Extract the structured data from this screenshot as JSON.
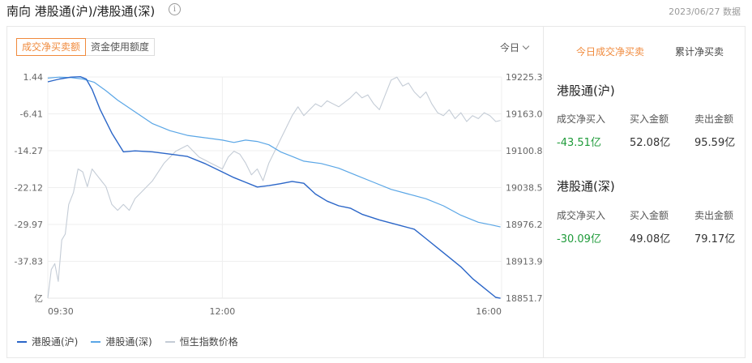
{
  "header": {
    "title": "南向 港股通(沪)/港股通(深)",
    "info_icon": "i",
    "date_note": "2023/06/27 数据"
  },
  "chart_tabs": [
    "成交净买卖额",
    "资金使用额度"
  ],
  "period_selector": "今日",
  "side": {
    "tabs": [
      "今日成交净买卖",
      "累计净买卖"
    ],
    "blocks": [
      {
        "name": "港股通(沪)",
        "labels": [
          "成交净买入",
          "买入金额",
          "卖出金额"
        ],
        "values": [
          "-43.51亿",
          "52.08亿",
          "95.59亿"
        ]
      },
      {
        "name": "港股通(深)",
        "labels": [
          "成交净买入",
          "买入金额",
          "卖出金额"
        ],
        "values": [
          "-30.09亿",
          "49.08亿",
          "79.17亿"
        ]
      }
    ]
  },
  "colors": {
    "accent": "#f08a3c",
    "sh_line": "#2b66c8",
    "sz_line": "#5aa6e6",
    "hsi_line": "#c4ccd6",
    "negative": "#1f9b3a"
  },
  "chart_data": {
    "type": "line",
    "x_ticks": [
      "09:30",
      "12:00",
      "16:00"
    ],
    "y_left_unit": "亿",
    "y_left_ticks": [
      "1.44",
      "-6.41",
      "-14.27",
      "-22.12",
      "-29.97",
      "-37.83"
    ],
    "y_left_range": [
      -45.68,
      1.44
    ],
    "y_right_ticks": [
      "19225.3",
      "19163.0",
      "19100.8",
      "19038.5",
      "18976.2",
      "18913.9",
      "18851.7"
    ],
    "y_right_range": [
      18851.7,
      19225.3
    ],
    "x_range_min": [
      0,
      390
    ],
    "series": [
      {
        "name": "港股通(沪)",
        "axis": "left",
        "points": [
          [
            0,
            0.4
          ],
          [
            10,
            1.0
          ],
          [
            20,
            1.4
          ],
          [
            28,
            1.5
          ],
          [
            33,
            1.0
          ],
          [
            38,
            -1.2
          ],
          [
            45,
            -5.5
          ],
          [
            55,
            -10.5
          ],
          [
            65,
            -14.5
          ],
          [
            75,
            -14.3
          ],
          [
            90,
            -14.5
          ],
          [
            105,
            -15.0
          ],
          [
            120,
            -15.5
          ],
          [
            135,
            -17.0
          ],
          [
            150,
            -18.8
          ],
          [
            160,
            -20.0
          ],
          [
            170,
            -21.0
          ],
          [
            180,
            -22.0
          ],
          [
            190,
            -21.7
          ],
          [
            200,
            -21.3
          ],
          [
            210,
            -20.8
          ],
          [
            220,
            -21.2
          ],
          [
            230,
            -23.5
          ],
          [
            240,
            -25.0
          ],
          [
            250,
            -26.0
          ],
          [
            260,
            -26.5
          ],
          [
            270,
            -27.8
          ],
          [
            285,
            -29.0
          ],
          [
            300,
            -30.0
          ],
          [
            315,
            -31.0
          ],
          [
            325,
            -33.0
          ],
          [
            335,
            -35.0
          ],
          [
            345,
            -37.0
          ],
          [
            355,
            -39.0
          ],
          [
            365,
            -41.5
          ],
          [
            375,
            -43.5
          ],
          [
            385,
            -45.5
          ],
          [
            389,
            -45.7
          ]
        ]
      },
      {
        "name": "港股通(深)",
        "axis": "left",
        "points": [
          [
            0,
            1.2
          ],
          [
            10,
            1.4
          ],
          [
            20,
            1.3
          ],
          [
            30,
            1.0
          ],
          [
            40,
            0.3
          ],
          [
            50,
            -1.5
          ],
          [
            60,
            -3.5
          ],
          [
            75,
            -6.0
          ],
          [
            90,
            -8.5
          ],
          [
            105,
            -10.0
          ],
          [
            120,
            -11.0
          ],
          [
            135,
            -11.5
          ],
          [
            150,
            -12.0
          ],
          [
            160,
            -12.5
          ],
          [
            170,
            -12.0
          ],
          [
            180,
            -12.3
          ],
          [
            190,
            -13.0
          ],
          [
            200,
            -14.5
          ],
          [
            210,
            -15.5
          ],
          [
            220,
            -16.5
          ],
          [
            235,
            -17.0
          ],
          [
            250,
            -18.0
          ],
          [
            265,
            -19.5
          ],
          [
            280,
            -21.0
          ],
          [
            295,
            -22.5
          ],
          [
            310,
            -23.5
          ],
          [
            325,
            -24.5
          ],
          [
            340,
            -26.0
          ],
          [
            355,
            -28.0
          ],
          [
            370,
            -29.5
          ],
          [
            380,
            -30.0
          ],
          [
            389,
            -30.5
          ]
        ]
      },
      {
        "name": "恒生指数价格",
        "axis": "right",
        "points": [
          [
            0,
            18852
          ],
          [
            3,
            18900
          ],
          [
            6,
            18910
          ],
          [
            9,
            18880
          ],
          [
            12,
            18950
          ],
          [
            15,
            18960
          ],
          [
            18,
            19010
          ],
          [
            22,
            19030
          ],
          [
            26,
            19070
          ],
          [
            30,
            19065
          ],
          [
            34,
            19040
          ],
          [
            38,
            19070
          ],
          [
            42,
            19060
          ],
          [
            46,
            19050
          ],
          [
            50,
            19040
          ],
          [
            55,
            19010
          ],
          [
            60,
            19000
          ],
          [
            65,
            19010
          ],
          [
            70,
            19000
          ],
          [
            75,
            19020
          ],
          [
            80,
            19030
          ],
          [
            85,
            19040
          ],
          [
            90,
            19050
          ],
          [
            100,
            19080
          ],
          [
            110,
            19100
          ],
          [
            120,
            19110
          ],
          [
            130,
            19090
          ],
          [
            140,
            19080
          ],
          [
            150,
            19070
          ],
          [
            155,
            19090
          ],
          [
            160,
            19100
          ],
          [
            165,
            19095
          ],
          [
            170,
            19080
          ],
          [
            175,
            19060
          ],
          [
            180,
            19070
          ],
          [
            185,
            19050
          ],
          [
            190,
            19080
          ],
          [
            195,
            19100
          ],
          [
            200,
            19120
          ],
          [
            205,
            19140
          ],
          [
            210,
            19160
          ],
          [
            215,
            19175
          ],
          [
            220,
            19160
          ],
          [
            225,
            19170
          ],
          [
            230,
            19180
          ],
          [
            235,
            19175
          ],
          [
            240,
            19185
          ],
          [
            250,
            19175
          ],
          [
            260,
            19190
          ],
          [
            265,
            19200
          ],
          [
            270,
            19190
          ],
          [
            275,
            19195
          ],
          [
            280,
            19180
          ],
          [
            285,
            19170
          ],
          [
            290,
            19195
          ],
          [
            295,
            19220
          ],
          [
            300,
            19225
          ],
          [
            305,
            19210
          ],
          [
            310,
            19215
          ],
          [
            315,
            19200
          ],
          [
            320,
            19190
          ],
          [
            325,
            19200
          ],
          [
            330,
            19180
          ],
          [
            335,
            19165
          ],
          [
            340,
            19160
          ],
          [
            345,
            19170
          ],
          [
            350,
            19155
          ],
          [
            355,
            19165
          ],
          [
            360,
            19150
          ],
          [
            365,
            19160
          ],
          [
            370,
            19155
          ],
          [
            375,
            19165
          ],
          [
            380,
            19160
          ],
          [
            385,
            19150
          ],
          [
            389,
            19152
          ]
        ]
      }
    ],
    "legend": [
      "港股通(沪)",
      "港股通(深)",
      "恒生指数价格"
    ],
    "grid": true,
    "legend_position": "bottom-left"
  }
}
